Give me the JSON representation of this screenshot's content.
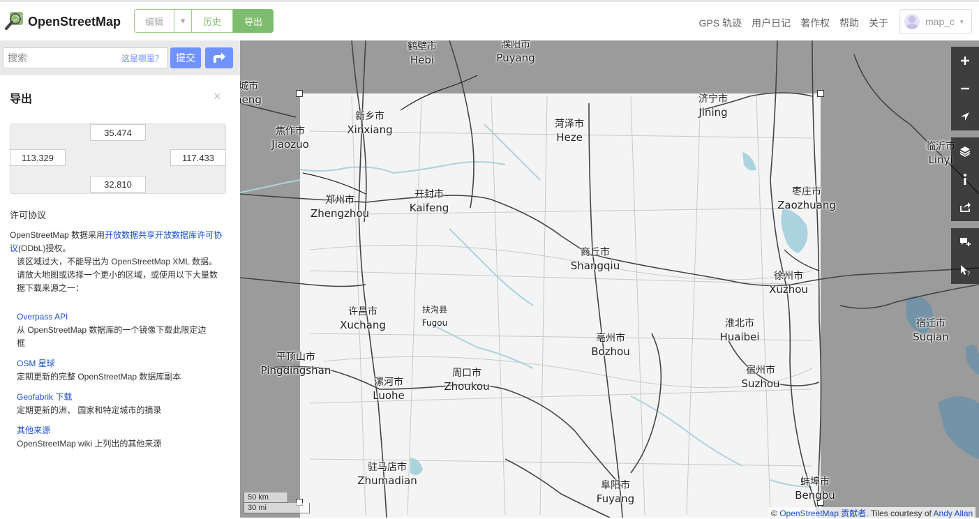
{
  "header": {
    "logo_icon": "magnifier-map-icon",
    "title": "OpenStreetMap",
    "tabs": {
      "edit": "编辑",
      "edit_caret": "▾",
      "history": "历史",
      "export": "导出"
    },
    "links": [
      "GPS 轨迹",
      "用户日记",
      "著作权",
      "帮助",
      "关于"
    ],
    "user": {
      "name": "map_c",
      "caret": "▾"
    },
    "accent_color": "#7ebc6f"
  },
  "search": {
    "placeholder": "搜索",
    "where_link": "这是哪里？",
    "submit": "提交",
    "directions_icon": "directions-icon",
    "button_color": "#7092ff"
  },
  "sidebar": {
    "title": "导出",
    "close": "×",
    "bbox": {
      "north": "35.474",
      "west": "113.329",
      "east": "117.433",
      "south": "32.810"
    },
    "license_heading": "许可协议",
    "license_prefix": "OpenStreetMap 数据采用",
    "license_link": "开放数据共享开放数据库许可协议",
    "license_suffix": "(ODbL)授权。",
    "too_large_line1": "该区域过大，不能导出为 OpenStreetMap XML 数据。",
    "too_large_line2": "请放大地图或选择一个更小的区域，或使用以下大量数",
    "too_large_line3": "据下载来源之一：",
    "sources": [
      {
        "name": "Overpass API",
        "desc_line1": "从 OpenStreetMap 数据库的一个镜像下载此限定边",
        "desc_line2": "框"
      },
      {
        "name": "OSM 星球",
        "desc_line1": "定期更新的完整 OpenStreetMap 数据库副本",
        "desc_line2": ""
      },
      {
        "name": "Geofabrik 下载",
        "desc_line1": "定期更新的洲、 国家和特定城市的摘录",
        "desc_line2": ""
      },
      {
        "name": "其他来源",
        "desc_line1": "OpenStreetMap wiki 上列出的其他来源",
        "desc_line2": ""
      }
    ]
  },
  "map": {
    "cities": [
      {
        "cn": "鹤壁市",
        "en": "Hebi"
      },
      {
        "cn": "濮阳市",
        "en": "Puyang"
      },
      {
        "cn": "济宁市",
        "en": "Jining"
      },
      {
        "cn": "新乡市",
        "en": "Xinxiang"
      },
      {
        "cn": "焦作市",
        "en": "Jiaozuo"
      },
      {
        "cn": "菏泽市",
        "en": "Heze"
      },
      {
        "cn": "临沂市",
        "en": "Linyi"
      },
      {
        "cn": "郑州市",
        "en": "Zhengzhou"
      },
      {
        "cn": "开封市",
        "en": "Kaifeng"
      },
      {
        "cn": "枣庄市",
        "en": "Zaozhuang"
      },
      {
        "cn": "商丘市",
        "en": "Shangqiu"
      },
      {
        "cn": "徐州市",
        "en": "Xuzhou"
      },
      {
        "cn": "许昌市",
        "en": "Xuchang"
      },
      {
        "cn": "扶沟县",
        "en": "Fugou"
      },
      {
        "cn": "淮北市",
        "en": "Huaibei"
      },
      {
        "cn": "宿迁市",
        "en": "Suqian"
      },
      {
        "cn": "亳州市",
        "en": "Bozhou"
      },
      {
        "cn": "平顶山市",
        "en": "Pingdingshan"
      },
      {
        "cn": "宿州市",
        "en": "Suzhou"
      },
      {
        "cn": "周口市",
        "en": "Zhoukou"
      },
      {
        "cn": "漯河市",
        "en": "Luohe"
      },
      {
        "cn": "驻马店市",
        "en": "Zhumadian"
      },
      {
        "cn": "阜阳市",
        "en": "Fuyang"
      },
      {
        "cn": "蚌埠市",
        "en": "Bengbu"
      },
      {
        "cn": "城市",
        "en": "heng"
      }
    ],
    "controls": [
      "zoom-in-icon",
      "zoom-out-icon",
      "locate-icon",
      "layers-icon",
      "info-icon",
      "share-icon",
      "note-icon",
      "query-icon"
    ],
    "scale_km": "50 km",
    "scale_mi": "30 mi",
    "attribution": {
      "prefix": "© ",
      "link1": "OpenStreetMap 贡献者",
      "middle": ". Tiles courtesy of ",
      "link2": "Andy Allan"
    },
    "water_color": "#aad3df"
  }
}
